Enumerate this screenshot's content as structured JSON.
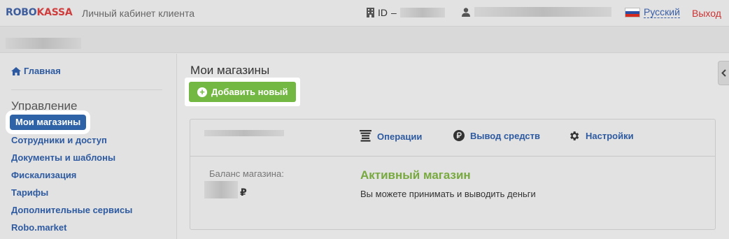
{
  "header": {
    "logo_part1": "ROBO",
    "logo_part2": "KASSA",
    "cabinet_title": "Личный кабинет клиента",
    "id_label": "ID",
    "id_separator": "–",
    "language": "Русский",
    "logout": "Выход"
  },
  "sidebar": {
    "home": "Главная",
    "section_title": "Управление",
    "items": [
      {
        "label": "Мои магазины"
      },
      {
        "label": "Сотрудники и доступ"
      },
      {
        "label": "Документы и шаблоны"
      },
      {
        "label": "Фискализация"
      },
      {
        "label": "Тарифы"
      },
      {
        "label": "Дополнительные сервисы"
      },
      {
        "label": "Robo.market"
      }
    ]
  },
  "main": {
    "title": "Мои магазины",
    "add_button": "Добавить новый",
    "shop": {
      "actions": [
        {
          "label": "Операции",
          "icon": "operations-icon"
        },
        {
          "label": "Вывод средств",
          "icon": "ruble-icon"
        },
        {
          "label": "Настройки",
          "icon": "gear-icon"
        }
      ],
      "balance_label": "Баланс магазина:",
      "currency": "₽",
      "status": "Активный магазин",
      "status_desc": "Вы можете принимать и выводить деньги"
    }
  },
  "colors": {
    "link": "#2d5aa0",
    "logo_blue": "#3e5d9c",
    "logo_red": "#cf3d3d",
    "active_pill": "#2f63a7",
    "add_button": "#74b844",
    "status_green": "#77a93f",
    "logout": "#cc3333"
  }
}
